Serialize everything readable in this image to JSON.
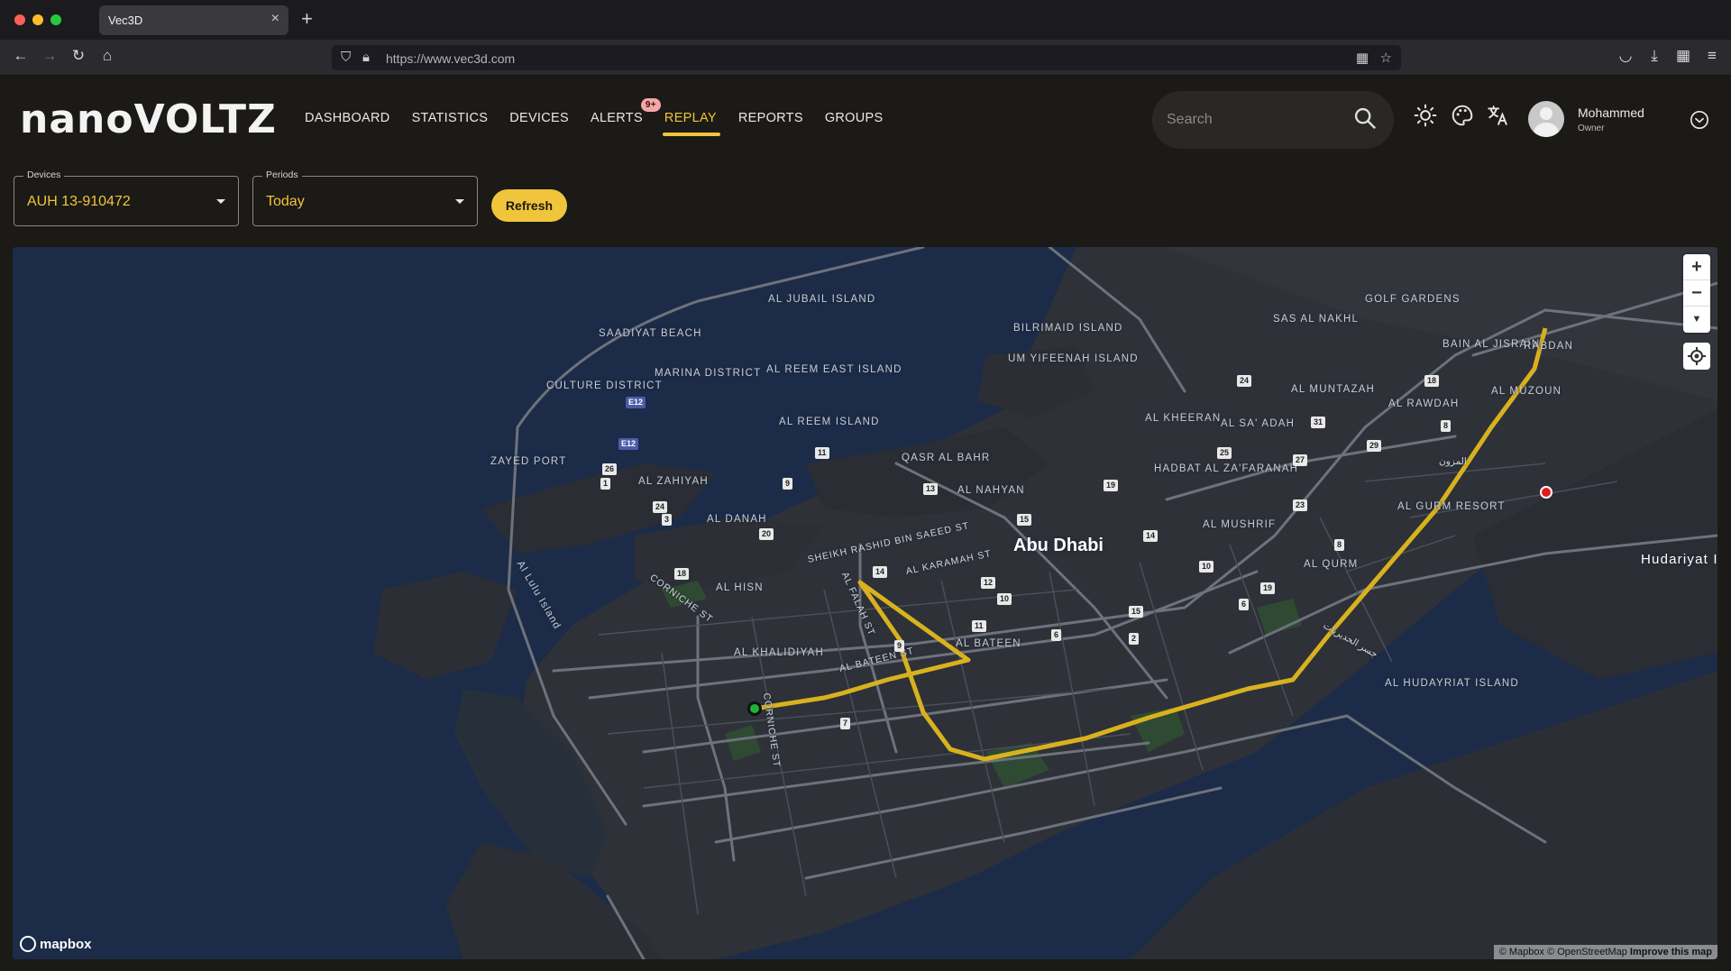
{
  "browser": {
    "tab_title": "Vec3D",
    "url": "https://www.vec3d.com"
  },
  "app": {
    "logo": "nanoVOLTZ",
    "menu": [
      {
        "label": "DASHBOARD"
      },
      {
        "label": "STATISTICS"
      },
      {
        "label": "DEVICES"
      },
      {
        "label": "ALERTS",
        "badge": "9+"
      },
      {
        "label": "REPLAY",
        "active": true
      },
      {
        "label": "REPORTS"
      },
      {
        "label": "GROUPS"
      }
    ],
    "search": {
      "placeholder": "Search"
    },
    "user": {
      "name": "Mohammed",
      "role": "Owner"
    },
    "accent_color": "#f0c53c"
  },
  "controls": {
    "devices": {
      "label": "Devices",
      "value": "AUH 13-910472"
    },
    "periods": {
      "label": "Periods",
      "value": "Today"
    },
    "refresh_label": "Refresh"
  },
  "map": {
    "city": "Abu Dhabi",
    "labels": [
      "AL JUBAIL ISLAND",
      "SAADIYAT BEACH",
      "MARINA DISTRICT",
      "CULTURE DISTRICT",
      "AL REEM EAST ISLAND",
      "BILRIMAID ISLAND",
      "UM YIFEENAH ISLAND",
      "SAS AL NAKHL",
      "GOLF GARDENS",
      "BAIN AL JISRAIN",
      "RABDAN",
      "AL MUZOUN",
      "AL MUNTAZAH",
      "AL RAWDAH",
      "AL REEM ISLAND",
      "ZAYED PORT",
      "AL ZAHIYAH",
      "QASR AL BAHR",
      "AL NAHYAN",
      "AL KHEERAN",
      "AL SA' ADAH",
      "HADBAT AL ZA'FARANAH",
      "AL DANAH",
      "AL MUSHRIF",
      "AL GURM RESORT",
      "AL QURM",
      "AL HISN",
      "AL KHALIDIYAH",
      "AL BATEEN",
      "AL HUDAYRIAT ISLAND",
      "Hudariyat I",
      "Al Lulu Island"
    ],
    "streets": [
      "SHEIKH RASHID BIN SAEED ST",
      "AL KARAMAH ST",
      "AL FALAH ST",
      "CORNICHE ST",
      "AL BATEEN ST",
      "CORNICHE ST",
      "جسر الحديريات",
      "المزون"
    ],
    "shields": [
      "E12",
      "E12",
      "26",
      "1",
      "24",
      "3",
      "18",
      "20",
      "11",
      "9",
      "13",
      "15",
      "14",
      "12",
      "10",
      "11",
      "9",
      "6",
      "2",
      "15",
      "6",
      "19",
      "10",
      "14",
      "19",
      "23",
      "25",
      "27",
      "31",
      "24",
      "29",
      "8",
      "18",
      "8",
      "7"
    ],
    "zoom_in": "+",
    "zoom_out": "−",
    "compass": "▼",
    "attribution": "© Mapbox © OpenStreetMap",
    "improve": "Improve this map",
    "mapbox_logo": "mapbox"
  }
}
